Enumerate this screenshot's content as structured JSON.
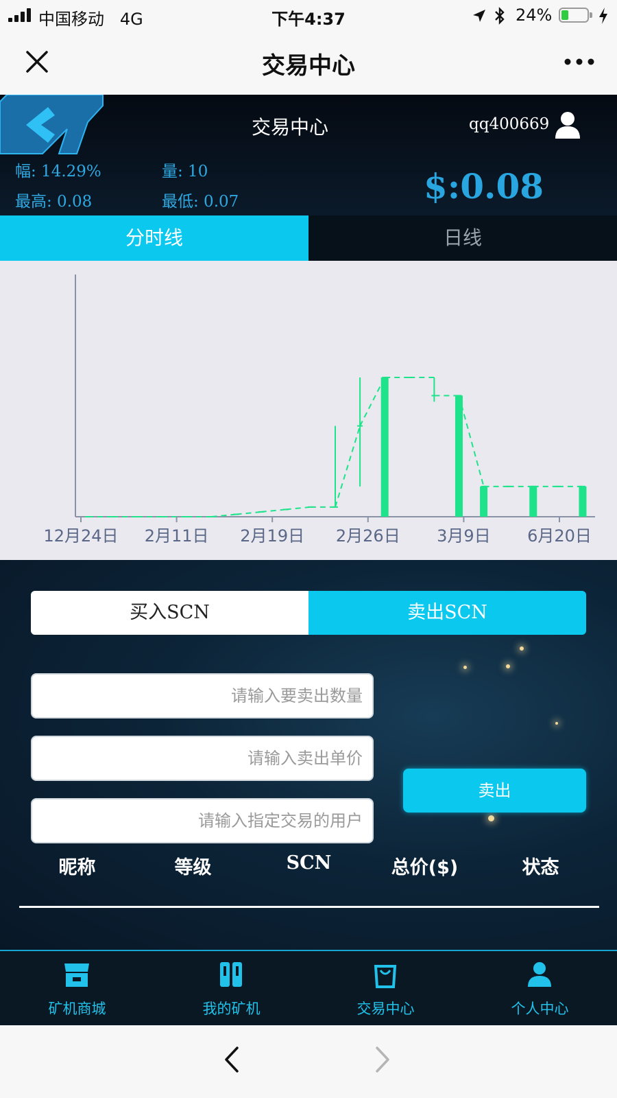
{
  "status_bar": {
    "carrier": "中国移动",
    "network": "4G",
    "time": "下午4:37",
    "battery": "24%"
  },
  "nav_bar": {
    "title": "交易中心"
  },
  "header": {
    "title": "交易中心",
    "username": "qq400669",
    "change": "幅: 14.29%",
    "volume": "量: 10",
    "high": "最高: 0.08",
    "low": "最低: 0.07",
    "price": "$:0.08"
  },
  "chart_tabs": {
    "active": "分时线",
    "inactive": "日线"
  },
  "chart_data": {
    "type": "bar",
    "x_tick_labels": [
      "12月24日",
      "2月11日",
      "2月19日",
      "2月26日",
      "3月9日",
      "6月20日"
    ],
    "candles": [
      {
        "open": 0.07,
        "close": 0.07,
        "high": 0.07,
        "low": 0.07
      },
      {
        "open": 0.07,
        "close": 0.07,
        "high": 0.07,
        "low": 0.07
      },
      {
        "open": 0.07,
        "close": 0.07,
        "high": 0.07,
        "low": 0.07
      },
      {
        "open": 0.07,
        "close": 0.07,
        "high": 0.07,
        "low": 0.07
      },
      {
        "open": 0.07,
        "close": 0.07,
        "high": 0.07,
        "low": 0.07
      },
      {
        "open": 0.07,
        "close": 0.07,
        "high": 0.07,
        "low": 0.07
      },
      {
        "open": 0.0702,
        "close": 0.0702,
        "high": 0.0702,
        "low": 0.0702
      },
      {
        "open": 0.0704,
        "close": 0.0704,
        "high": 0.0704,
        "low": 0.0704
      },
      {
        "open": 0.0706,
        "close": 0.0706,
        "high": 0.0706,
        "low": 0.0706
      },
      {
        "open": 0.0708,
        "close": 0.0708,
        "high": 0.0708,
        "low": 0.0708
      },
      {
        "open": 0.0708,
        "close": 0.0708,
        "high": 0.0775,
        "low": 0.0708
      },
      {
        "open": 0.0775,
        "close": 0.0775,
        "high": 0.0815,
        "low": 0.0725
      },
      {
        "open": 0.0815,
        "close": 0.0815,
        "high": 0.0815,
        "low": 0.0815
      },
      {
        "open": 0.0815,
        "close": 0.0815,
        "high": 0.0815,
        "low": 0.0815
      },
      {
        "open": 0.0815,
        "close": 0.08,
        "high": 0.0815,
        "low": 0.0795
      },
      {
        "open": 0.08,
        "close": 0.08,
        "high": 0.08,
        "low": 0.08
      },
      {
        "open": 0.0725,
        "close": 0.0725,
        "high": 0.0725,
        "low": 0.0725
      },
      {
        "open": 0.0725,
        "close": 0.0725,
        "high": 0.0725,
        "low": 0.0725
      },
      {
        "open": 0.0725,
        "close": 0.0725,
        "high": 0.0725,
        "low": 0.0725
      },
      {
        "open": 0.0725,
        "close": 0.0725,
        "high": 0.0725,
        "low": 0.0725
      },
      {
        "open": 0.0725,
        "close": 0.0725,
        "high": 0.0725,
        "low": 0.0725
      }
    ],
    "volumes": [
      0,
      0,
      0,
      0,
      0,
      0,
      0,
      0,
      0,
      0,
      0,
      0,
      0.0815,
      0,
      0,
      0.08,
      0.0725,
      0,
      0.0725,
      0,
      0.0725
    ],
    "ylim": [
      0.07,
      0.09
    ],
    "colors": {
      "bar": "#1ee38a",
      "line": "#1ee38a",
      "axis": "#8a93a6",
      "tick_text": "#5b6787"
    }
  },
  "trade": {
    "buy_tab": "买入SCN",
    "sell_tab": "卖出SCN",
    "qty_placeholder": "请输入要卖出数量",
    "price_placeholder": "请输入卖出单价",
    "user_placeholder": "请输入指定交易的用户",
    "sell_button": "卖出"
  },
  "table": {
    "columns": [
      "昵称",
      "等级",
      "SCN",
      "总价($)",
      "状态"
    ]
  },
  "bottom_nav": {
    "items": [
      "矿机商城",
      "我的矿机",
      "交易中心",
      "个人中心"
    ]
  },
  "colors": {
    "accent": "#0bc8ee",
    "price": "#29a6e0",
    "stat": "#2ea8e0"
  }
}
